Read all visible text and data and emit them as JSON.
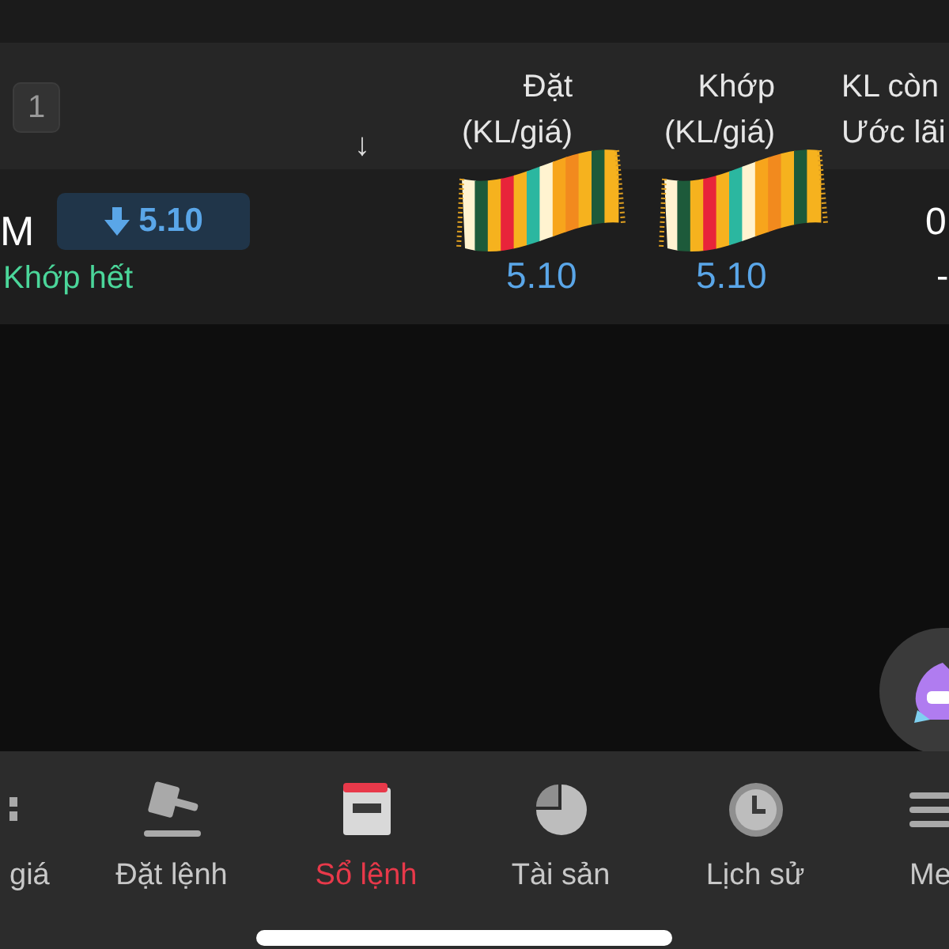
{
  "header": {
    "badge": "1",
    "sort_arrow": "↓",
    "columns": [
      {
        "line1": "Đặt",
        "line2": "(KL/giá)"
      },
      {
        "line1": "Khớp",
        "line2": "(KL/giá)"
      },
      {
        "line1": "KL còn",
        "line2": "Ước lãi"
      }
    ]
  },
  "order": {
    "symbol": "M",
    "price_chip": "5.10",
    "status": "Khớp hết",
    "order_price": "5.10",
    "match_price": "5.10",
    "remaining": "0",
    "estimate": "-"
  },
  "nav": [
    {
      "label": "giá",
      "kind": "grid",
      "selected": false
    },
    {
      "label": "Đặt lệnh",
      "kind": "gavel",
      "selected": false
    },
    {
      "label": "Sổ lệnh",
      "kind": "book",
      "selected": true
    },
    {
      "label": "Tài sản",
      "kind": "pie",
      "selected": false
    },
    {
      "label": "Lịch sử",
      "kind": "clock",
      "selected": false
    },
    {
      "label": "Me",
      "kind": "menu",
      "selected": false
    }
  ]
}
